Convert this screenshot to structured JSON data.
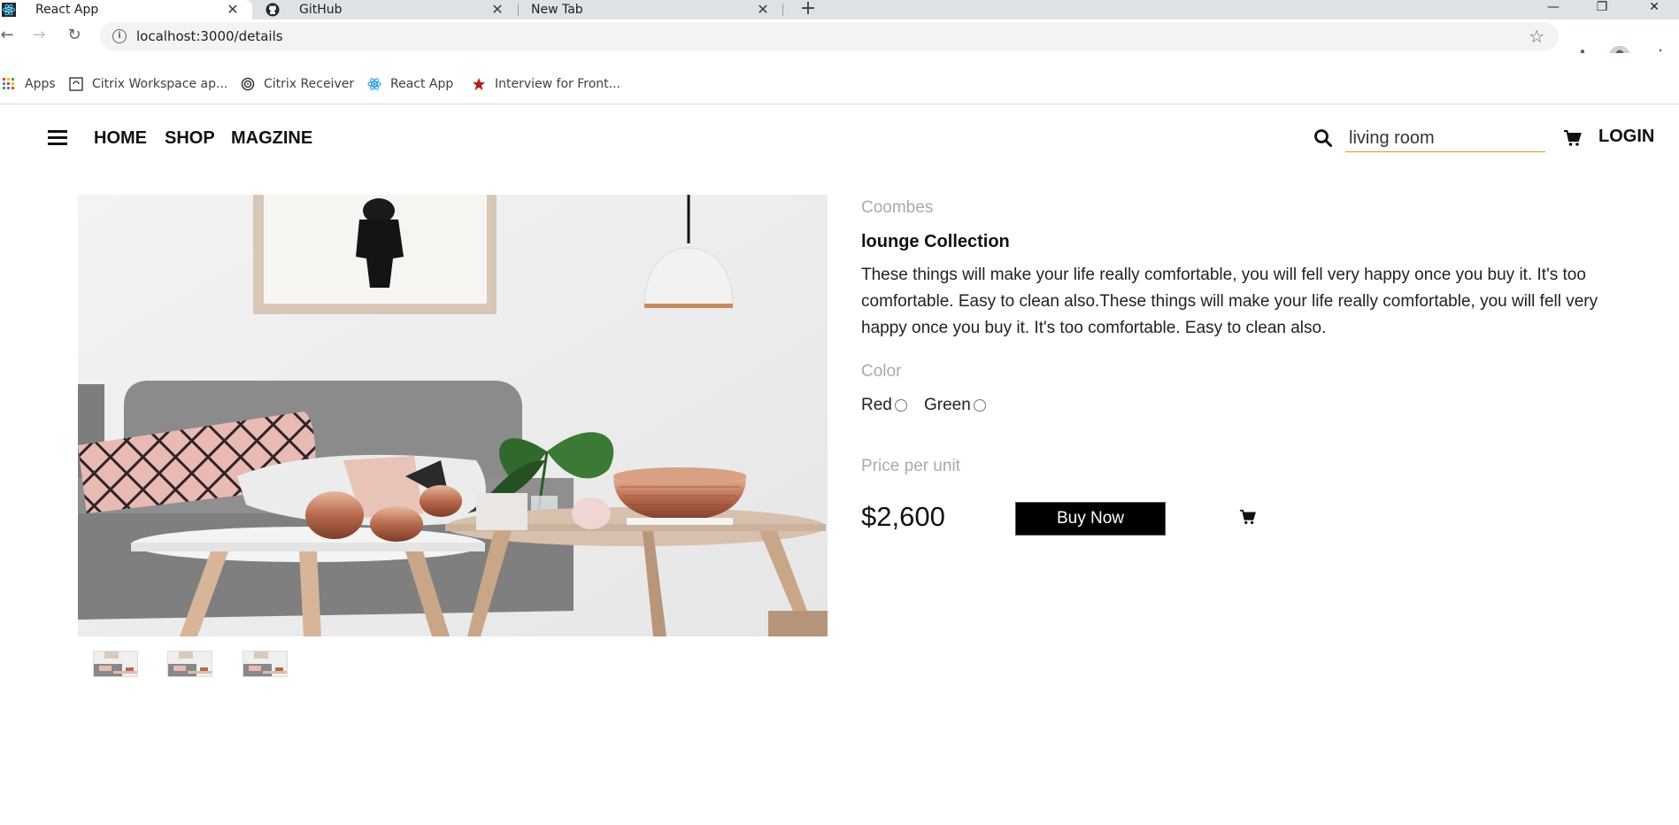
{
  "browser": {
    "tabs": [
      {
        "title": "React App",
        "icon": "react-icon",
        "active": true
      },
      {
        "title": "GitHub",
        "icon": "github-icon",
        "active": false
      },
      {
        "title": "New Tab",
        "icon": "none",
        "active": false
      }
    ],
    "url": "localhost:3000/details",
    "bookmarks": [
      {
        "label": "Apps",
        "icon": "apps-grid-icon"
      },
      {
        "label": "Citrix Workspace ap...",
        "icon": "citrix-workspace-icon"
      },
      {
        "label": "Citrix Receiver",
        "icon": "citrix-receiver-icon"
      },
      {
        "label": "React App",
        "icon": "react-icon"
      },
      {
        "label": "Interview for Front...",
        "icon": "star-bookmark-icon"
      }
    ]
  },
  "header": {
    "nav": [
      {
        "label": "HOME"
      },
      {
        "label": "SHOP"
      },
      {
        "label": "MAGZINE"
      }
    ],
    "search_value": "living room",
    "login_label": "LOGIN"
  },
  "product": {
    "brand": "Coombes",
    "title": "lounge Collection",
    "description": "These things will make your life really comfortable, you will fell very happy once you buy it. It's too comfortable. Easy to clean also.These things will make your life really comfortable, you will fell very happy once you buy it. It's too comfortable. Easy to clean also.",
    "color_label": "Color",
    "colors": [
      {
        "label": "Red",
        "checked": false
      },
      {
        "label": "Green",
        "checked": false
      }
    ],
    "price_label": "Price per unit",
    "price": "$2,600",
    "buy_label": "Buy Now",
    "thumbnail_count": 3
  },
  "colors": {
    "accent_underline": "#c9a227",
    "buy_button_bg": "#000000",
    "muted_text": "#aaaaaa"
  }
}
